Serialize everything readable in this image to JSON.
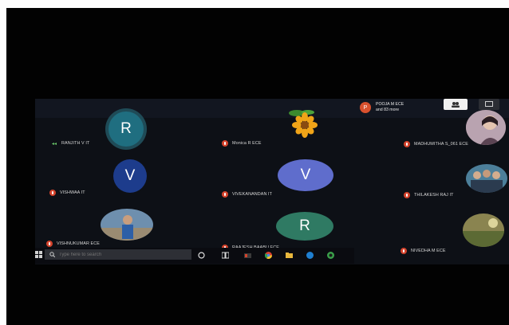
{
  "meeting": {
    "more_chip": {
      "avatar_letter": "P",
      "line1": "POOJA M ECE",
      "line2": "and 83 more"
    },
    "controls": [
      {
        "label": "",
        "icon": "participants-icon",
        "color": "#f2f2f2"
      },
      {
        "label": "",
        "icon": "chat-icon",
        "color": "#2b2d33"
      }
    ],
    "tiles": [
      {
        "name": "RANJITH V IT",
        "avatar": "R",
        "avatar_color": "#1f6e80",
        "muted": false
      },
      {
        "name": "Monica R ECE",
        "avatar": "",
        "muted": true,
        "picture": "sunflower"
      },
      {
        "name": "MADHUMITHA S_061 ECE",
        "avatar": "",
        "muted": true,
        "picture": "person-photo"
      },
      {
        "name": "VISHWAA IT",
        "avatar": "V",
        "avatar_color": "#1d3c8c",
        "muted": true
      },
      {
        "name": "VIVEKANANDAN IT",
        "avatar": "V",
        "avatar_color": "#5f6dcc",
        "muted": true
      },
      {
        "name": "THILAKESH RAJ IT",
        "avatar": "",
        "muted": true,
        "picture": "group-photo"
      },
      {
        "name": "VISHNUKUMAR ECE",
        "avatar": "",
        "muted": true,
        "picture": "person-photo"
      },
      {
        "name": "RAAJESH BAABU ECE",
        "avatar": "R",
        "avatar_color": "#2f7a63",
        "muted": true
      },
      {
        "name": "NIVEDHA M ECE",
        "avatar": "",
        "muted": true,
        "picture": "landscape-photo"
      }
    ]
  },
  "taskbar": {
    "search_placeholder": "Type here to search",
    "icons": [
      "windows-icon",
      "cortana-icon",
      "task-view-icon",
      "chrome-icon",
      "file-explorer-icon",
      "edge-icon",
      "store-icon"
    ]
  }
}
